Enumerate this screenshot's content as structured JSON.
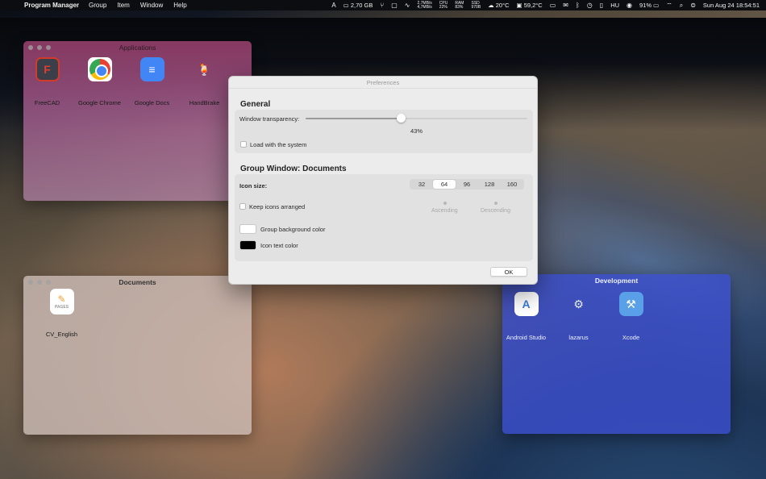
{
  "menubar": {
    "app_name": "Program Manager",
    "menus": [
      "Group",
      "Item",
      "Window",
      "Help"
    ],
    "status": {
      "memory": "2,70 GB",
      "net_up": "2,7MB/s",
      "net_down": "4,7MB/s",
      "cpu_label": "CPU",
      "cpu_value": "22%",
      "ram_label": "RAM",
      "ram_value": "83%",
      "ssd_label": "SSD",
      "ssd_value": "970B",
      "weather": "20°C",
      "temp": "59,2°C",
      "input_lang": "HU",
      "battery": "91%",
      "datetime": "Sun Aug 24  18:54:51"
    }
  },
  "windows": {
    "applications": {
      "title": "Applications",
      "items": [
        {
          "label": "FreeCAD",
          "icon": "freecad-icon"
        },
        {
          "label": "Google Chrome",
          "icon": "chrome-icon"
        },
        {
          "label": "Google Docs",
          "icon": "docs-icon"
        },
        {
          "label": "HandBrake",
          "icon": "handbrake-icon"
        }
      ]
    },
    "documents": {
      "title": "Documents",
      "items": [
        {
          "label": "CV_English",
          "icon": "pages-document-icon",
          "badge": "PAGES"
        }
      ]
    },
    "development": {
      "title": "Development",
      "items": [
        {
          "label": "Android Studio",
          "icon": "android-studio-icon"
        },
        {
          "label": "lazarus",
          "icon": "lazarus-icon"
        },
        {
          "label": "Xcode",
          "icon": "xcode-icon"
        }
      ]
    }
  },
  "preferences": {
    "title": "Preferences",
    "general_heading": "General",
    "transparency_label": "Window transparency:",
    "transparency_value": "43%",
    "transparency_fraction": 0.43,
    "load_with_system_label": "Load with the system",
    "load_with_system_checked": false,
    "group_heading": "Group Window: Documents",
    "icon_size_label": "Icon size:",
    "icon_sizes": [
      "32",
      "64",
      "96",
      "128",
      "160"
    ],
    "icon_size_selected": "64",
    "keep_arranged_label": "Keep icons arranged",
    "keep_arranged_checked": false,
    "ascending_label": "Ascending",
    "descending_label": "Descending",
    "bg_color_label": "Group background color",
    "bg_color": "#ffffff",
    "text_color_label": "Icon text color",
    "text_color": "#000000",
    "ok_label": "OK"
  }
}
